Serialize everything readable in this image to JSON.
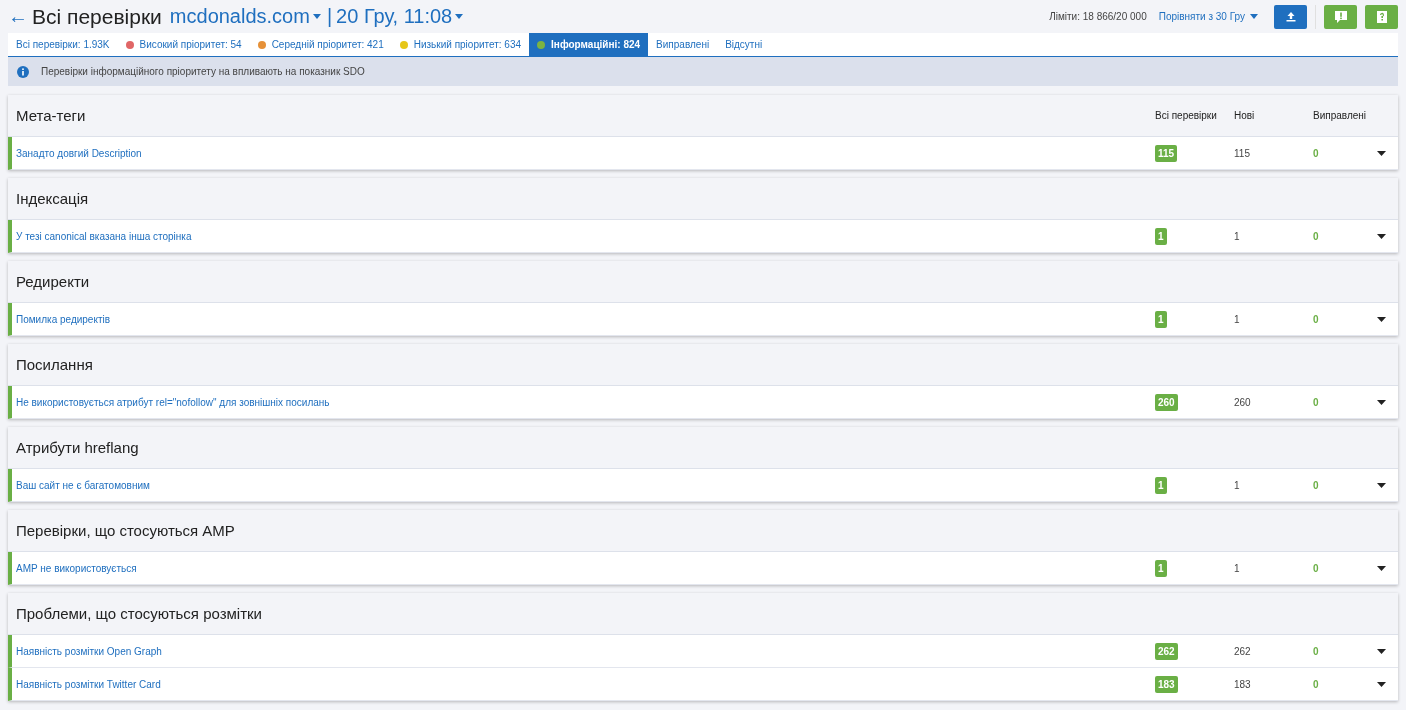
{
  "header": {
    "back": "←",
    "title": "Всі перевірки",
    "domain": "mcdonalds.com",
    "separator": "|",
    "date": "20 Гру, 11:08",
    "limits": "Ліміти: 18 866/20 000",
    "compare": "Порівняти з  30 Гру"
  },
  "tabs": [
    {
      "label": "Всі перевірки: 1.93K",
      "selected": false
    },
    {
      "label": "Високий пріоритет: 54",
      "selected": false,
      "color": "#e06666"
    },
    {
      "label": "Середній пріоритет: 421",
      "selected": false,
      "color": "#e69138"
    },
    {
      "label": "Низький пріоритет: 634",
      "selected": false,
      "color": "#e6c619"
    },
    {
      "label": "Інформаційні: 824",
      "selected": true,
      "color": "#7cb342"
    },
    {
      "label": "Виправлені",
      "selected": false
    },
    {
      "label": "Відсутні",
      "selected": false
    }
  ],
  "notice": "Перевірки інформаційного пріоритету на впливають на показник SDO",
  "columns": [
    "Всі перевірки",
    "Нові",
    "Виправлені"
  ],
  "sections": [
    {
      "title": "Мета-теги",
      "rows": [
        {
          "name": "Занадто довгий Description",
          "all": "115",
          "new": "115",
          "fixed": "0"
        }
      ]
    },
    {
      "title": "Індексація",
      "rows": [
        {
          "name": "У тезі canonical вказана інша сторінка",
          "all": "1",
          "new": "1",
          "fixed": "0"
        }
      ]
    },
    {
      "title": "Редиректи",
      "rows": [
        {
          "name": "Помилка редиректів",
          "all": "1",
          "new": "1",
          "fixed": "0"
        }
      ]
    },
    {
      "title": "Посилання",
      "rows": [
        {
          "name": "Не використовується атрибут rel=\"nofollow\" для зовнішніх посилань",
          "all": "260",
          "new": "260",
          "fixed": "0"
        }
      ]
    },
    {
      "title": "Атрибути hreflang",
      "rows": [
        {
          "name": "Ваш сайт не є багатомовним",
          "all": "1",
          "new": "1",
          "fixed": "0"
        }
      ]
    },
    {
      "title": "Перевірки, що стосуються AMP",
      "rows": [
        {
          "name": "AMP не використовується",
          "all": "1",
          "new": "1",
          "fixed": "0"
        }
      ]
    },
    {
      "title": "Проблеми, що стосуються розмітки",
      "rows": [
        {
          "name": "Наявність розмітки Open Graph",
          "all": "262",
          "new": "262",
          "fixed": "0"
        },
        {
          "name": "Наявність розмітки Twitter Card",
          "all": "183",
          "new": "183",
          "fixed": "0"
        }
      ]
    }
  ]
}
